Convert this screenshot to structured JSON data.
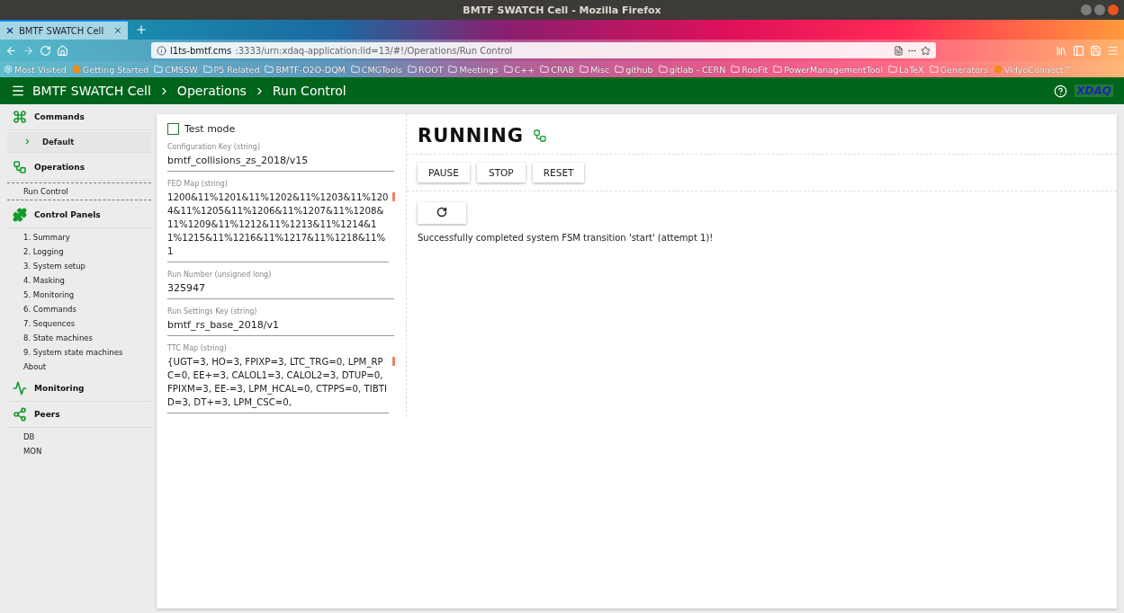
{
  "browser": {
    "window_title": "BMTF SWATCH Cell - Mozilla Firefox",
    "tabs": [
      {
        "label": "BMTF SWATCH Cell",
        "selected": true
      }
    ],
    "url": {
      "host": "l1ts-bmtf.cms",
      "path": ":3333/urn:xdaq-application:lid=13/#!/Operations/Run Control"
    },
    "bookmarks": [
      {
        "label": "Most Visited",
        "kind": "gear"
      },
      {
        "label": "Getting Started",
        "kind": "site"
      },
      {
        "label": "CMSSW",
        "kind": "folder"
      },
      {
        "label": "P5 Related",
        "kind": "folder"
      },
      {
        "label": "BMTF-O2O-DQM",
        "kind": "folder"
      },
      {
        "label": "CMGTools",
        "kind": "folder"
      },
      {
        "label": "ROOT",
        "kind": "folder"
      },
      {
        "label": "Meetings",
        "kind": "folder"
      },
      {
        "label": "C++",
        "kind": "folder"
      },
      {
        "label": "CRAB",
        "kind": "folder"
      },
      {
        "label": "Misc",
        "kind": "folder"
      },
      {
        "label": "github",
        "kind": "folder"
      },
      {
        "label": "gitlab - CERN",
        "kind": "folder"
      },
      {
        "label": "RooFit",
        "kind": "folder"
      },
      {
        "label": "PowerManagementTool",
        "kind": "folder"
      },
      {
        "label": "LaTeX",
        "kind": "folder"
      },
      {
        "label": "Generators",
        "kind": "folder"
      },
      {
        "label": "VidyoConnect™",
        "kind": "site"
      }
    ]
  },
  "app_header": {
    "title": "BMTF SWATCH Cell",
    "breadcrumbs": [
      "Operations",
      "Run Control"
    ],
    "logo": "XDAQ"
  },
  "sidebar": [
    {
      "title": "Commands",
      "items": [
        {
          "label": "Default",
          "kind": "group"
        }
      ]
    },
    {
      "title": "Operations",
      "items": [
        {
          "label": "Run Control",
          "kind": "current"
        }
      ]
    },
    {
      "title": "Control Panels",
      "items": [
        {
          "label": "1. Summary",
          "kind": "link"
        },
        {
          "label": "2. Logging",
          "kind": "link"
        },
        {
          "label": "3. System setup",
          "kind": "link"
        },
        {
          "label": "4. Masking",
          "kind": "link"
        },
        {
          "label": "5. Monitoring",
          "kind": "link"
        },
        {
          "label": "6. Commands",
          "kind": "link"
        },
        {
          "label": "7. Sequences",
          "kind": "link"
        },
        {
          "label": "8. State machines",
          "kind": "link"
        },
        {
          "label": "9. System state machines",
          "kind": "link"
        },
        {
          "label": "About",
          "kind": "link"
        }
      ]
    },
    {
      "title": "Monitoring"
    },
    {
      "title": "Peers",
      "items": [
        {
          "label": "DB",
          "kind": "link"
        },
        {
          "label": "MON",
          "kind": "link"
        }
      ]
    }
  ],
  "form": {
    "test_mode": {
      "label": "Test mode",
      "checked": false
    },
    "fields": [
      {
        "label": "Configuration Key (string)",
        "value": "bmtf_collisions_zs_2018/v15",
        "kind": "line"
      },
      {
        "label": "FED Map (string)",
        "value": "1200&11%1201&11%1202&11%1203&11%1204&11%1205&11%1206&11%1207&11%1208&11%1209&11%1212&11%1213&11%1214&11%1215&11%1216&11%1217&11%1218&11%1",
        "kind": "area"
      },
      {
        "label": "Run Number (unsigned long)",
        "value": "325947",
        "kind": "line"
      },
      {
        "label": "Run Settings Key (string)",
        "value": "bmtf_rs_base_2018/v1",
        "kind": "line"
      },
      {
        "label": "TTC Map (string)",
        "value": "{UGT=3, HO=3, FPIXP=3, LTC_TRG=0, LPM_RPC=0, EE+=3, CALOL1=3, CALOL2=3, DTUP=0, FPIXM=3, EE-=3, LPM_HCAL=0, CTPPS=0, TIBTID=3, DT+=3, LPM_CSC=0,",
        "kind": "area"
      }
    ]
  },
  "run_panel": {
    "state": "RUNNING",
    "buttons": [
      "PAUSE",
      "STOP",
      "RESET"
    ],
    "message": "Successfully completed system FSM transition 'start' (attempt 1)!"
  }
}
